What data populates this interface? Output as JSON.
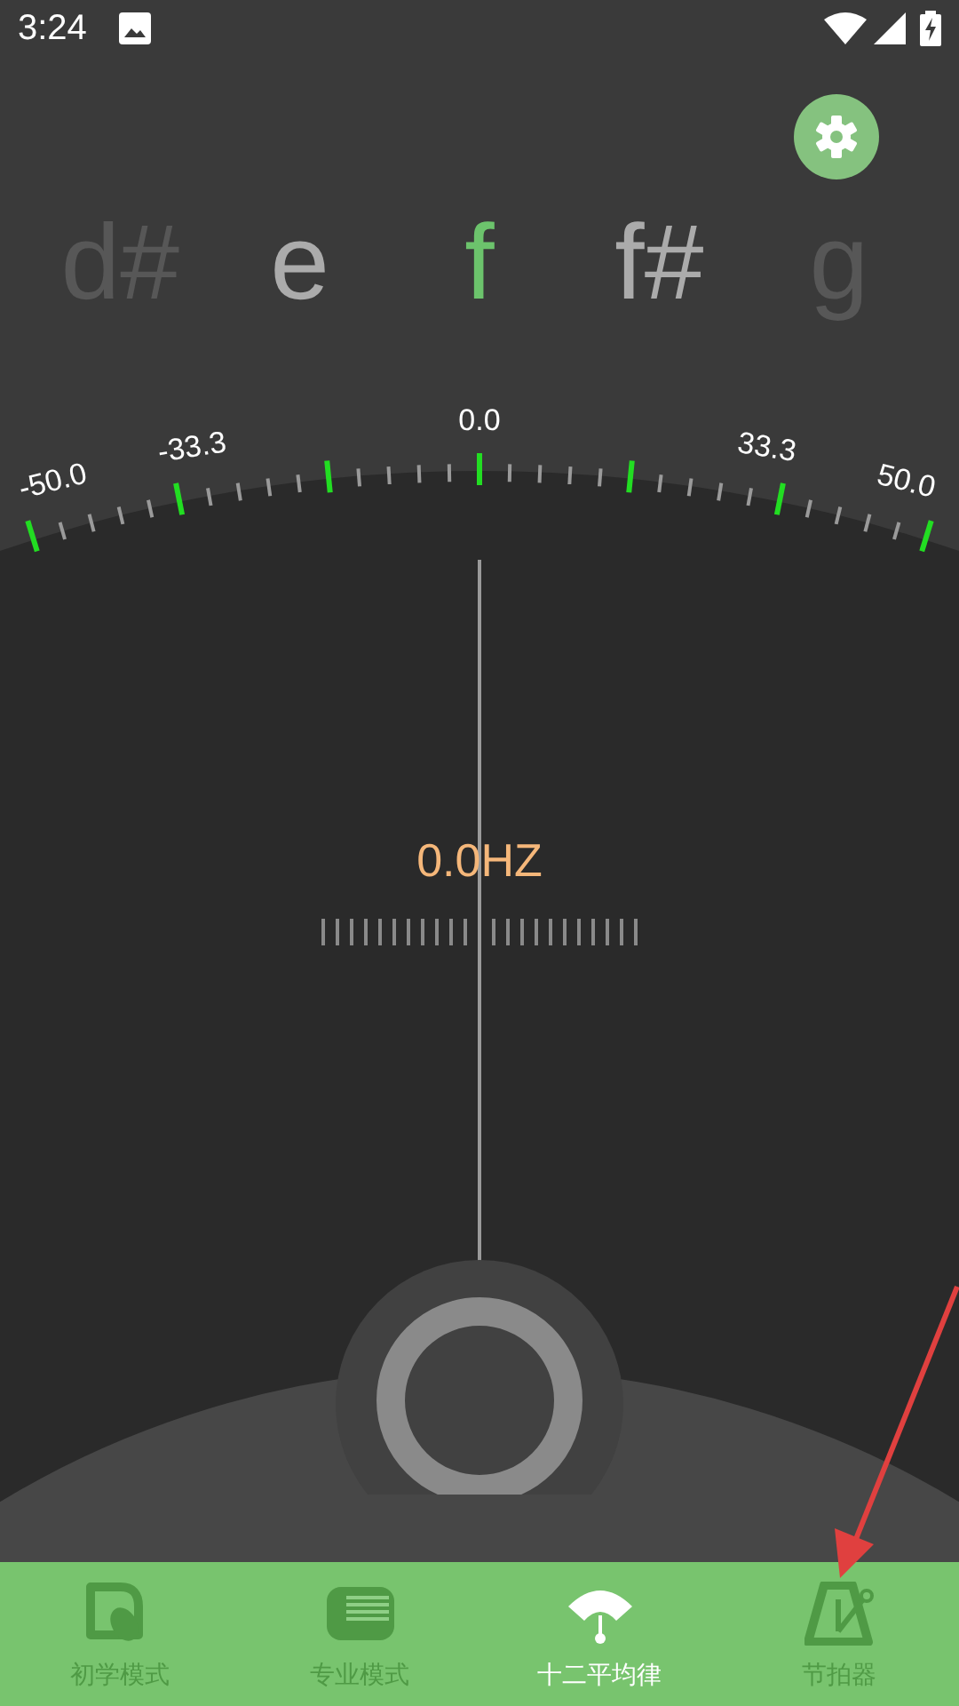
{
  "status_bar": {
    "time": "3:24"
  },
  "notes": [
    {
      "label": "d#",
      "color": "#575757"
    },
    {
      "label": "e",
      "color": "#ababab"
    },
    {
      "label": "f",
      "color": "#6cc36c"
    },
    {
      "label": "f#",
      "color": "#ababab"
    },
    {
      "label": "g",
      "color": "#575757"
    }
  ],
  "scale_labels": [
    "-50.0",
    "-33.3",
    "0.0",
    "33.3",
    "50.0"
  ],
  "frequency": "0.0HZ",
  "tabs": [
    {
      "label": "初学模式",
      "selected": false
    },
    {
      "label": "专业模式",
      "selected": false
    },
    {
      "label": "十二平均律",
      "selected": true
    },
    {
      "label": "节拍器",
      "selected": false
    }
  ]
}
